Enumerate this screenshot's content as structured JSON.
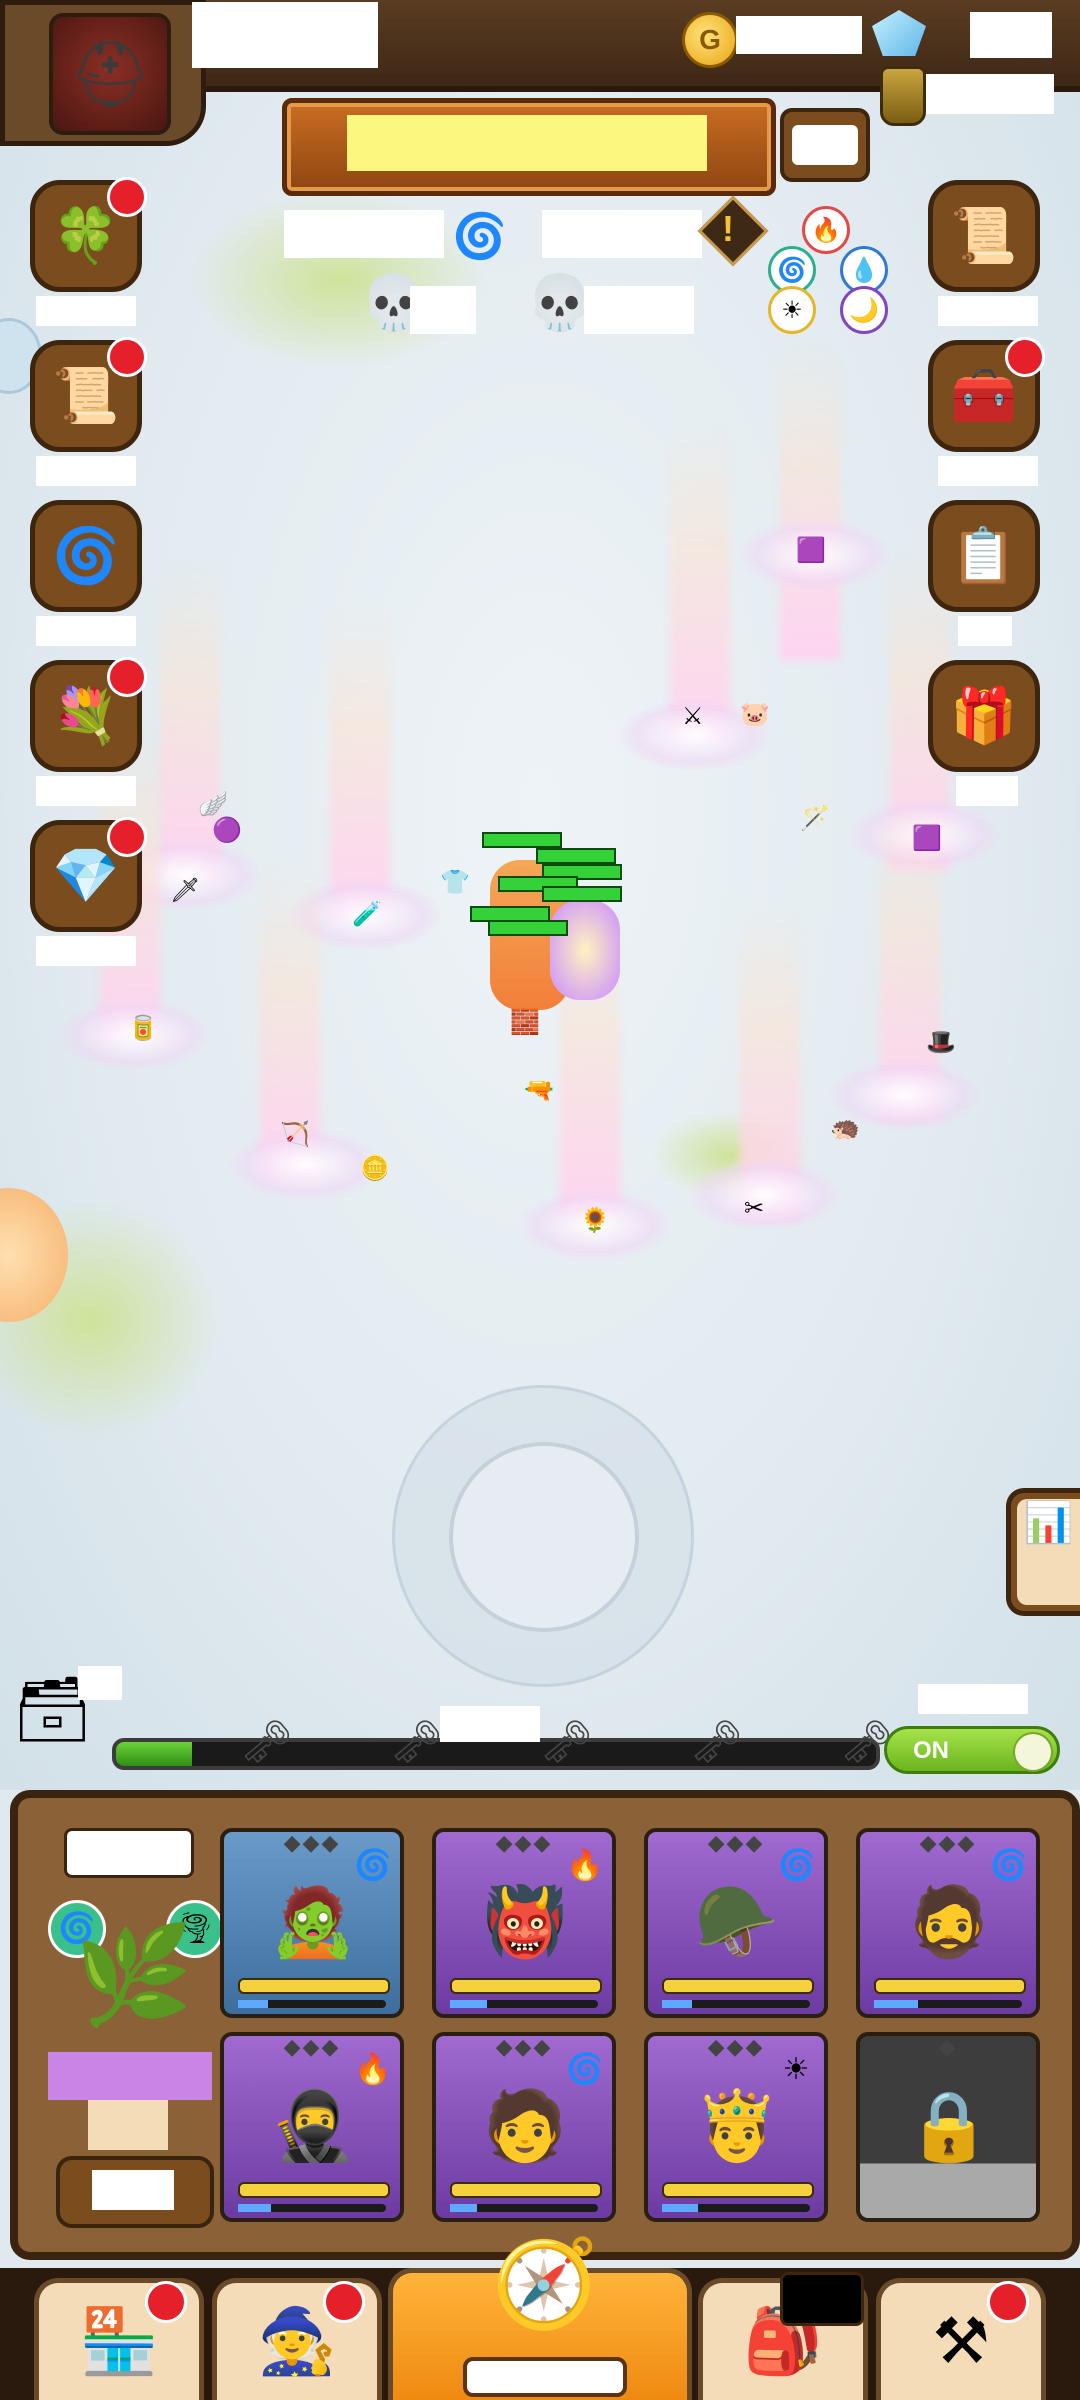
{
  "hud": {
    "avatar_icon": "knight-helmet-icon",
    "currency_icons": [
      "gold-coin-icon",
      "diamond-gem-icon",
      "potion-jar-icon"
    ],
    "coin_symbol": "G"
  },
  "toggle": {
    "label": "ON"
  },
  "progress": {
    "fill": 0.1
  },
  "side_buttons_left": [
    {
      "icon": "clover-icon",
      "glyph": "🍀",
      "badge": true
    },
    {
      "icon": "scroll-badge-icon",
      "glyph": "📜",
      "badge": true
    },
    {
      "icon": "portal-icon",
      "glyph": "🌀",
      "badge": false
    },
    {
      "icon": "bouquet-icon",
      "glyph": "💐",
      "badge": true
    },
    {
      "icon": "diamond-icon",
      "glyph": "💎",
      "badge": true
    }
  ],
  "side_buttons_right": [
    {
      "icon": "scroll-icon",
      "glyph": "📜",
      "badge": false
    },
    {
      "icon": "treasure-chest-icon",
      "glyph": "🧰",
      "badge": true
    },
    {
      "icon": "quest-board-icon",
      "glyph": "📋",
      "badge": false
    },
    {
      "icon": "cake-chest-icon",
      "glyph": "🎁",
      "badge": false
    }
  ],
  "heroes": [
    {
      "name_icon": "orc-archer-icon",
      "glyph": "🧟",
      "element": "🌀",
      "frame": "blue",
      "xp": 0.2
    },
    {
      "name_icon": "demon-icon",
      "glyph": "👹",
      "element": "🔥",
      "frame": "purple",
      "xp": 0.25
    },
    {
      "name_icon": "knight-icon",
      "glyph": "🪖",
      "element": "🌀",
      "frame": "purple",
      "xp": 0.2
    },
    {
      "name_icon": "scar-warrior-icon",
      "glyph": "🧔",
      "element": "🌀",
      "frame": "purple",
      "xp": 0.3
    },
    {
      "name_icon": "turban-assassin-icon",
      "glyph": "🥷",
      "element": "🔥",
      "frame": "purple",
      "xp": 0.22
    },
    {
      "name_icon": "ninja-icon",
      "glyph": "🧑",
      "element": "🌀",
      "frame": "purple",
      "xp": 0.18
    },
    {
      "name_icon": "king-icon",
      "glyph": "🤴",
      "element": "☀",
      "frame": "purple",
      "xp": 0.24
    },
    {
      "name_icon": "lock-icon",
      "glyph": "🔒",
      "element": "",
      "frame": "gray",
      "xp": 0
    }
  ],
  "nav": [
    {
      "icon": "shop-icon",
      "glyph": "🏪",
      "badge": true
    },
    {
      "icon": "hero-icon",
      "glyph": "🧙",
      "badge": true
    },
    {
      "icon": "backpack-icon",
      "glyph": "🎒",
      "badge": false
    },
    {
      "icon": "forge-icon",
      "glyph": "⚒",
      "badge": true
    }
  ],
  "nav_main": {
    "icon": "map-compass-icon",
    "glyph": "🧭"
  }
}
